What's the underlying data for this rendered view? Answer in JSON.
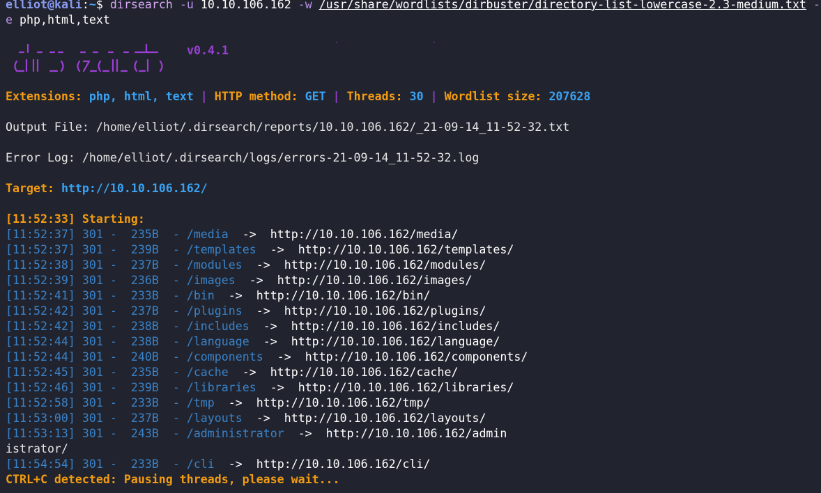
{
  "prompt": {
    "user": "elliot",
    "at": "@",
    "host": "kali",
    "sep": ":",
    "path": "~",
    "symbol": "$",
    "command": "dirsearch",
    "arg_u_flag": "-u",
    "target_ip": "10.10.106.162",
    "arg_w_flag": "-w",
    "wordlist": "/usr/share/wordlists/dirbuster/directory-list-lowercase-2.3-medium.txt",
    "arg_e_flag_start": "-",
    "arg_e_flag_end": "e",
    "extensions_arg": "php,html,text"
  },
  "banner": {
    "version": "v0.4.1"
  },
  "config": {
    "extensions_label": "Extensions:",
    "extensions_value": "php, html, text",
    "method_label": "HTTP method:",
    "method_value": "GET",
    "threads_label": "Threads:",
    "threads_value": "30",
    "wordlist_label": "Wordlist size:",
    "wordlist_value": "207628",
    "separator": "|"
  },
  "output_file": "Output File: /home/elliot/.dirsearch/reports/10.10.106.162/_21-09-14_11-52-32.txt",
  "error_log": "Error Log: /home/elliot/.dirsearch/logs/errors-21-09-14_11-52-32.log",
  "target": {
    "label": "Target:",
    "url": "http://10.10.106.162/"
  },
  "starting": "[11:52:33] Starting:",
  "results": [
    {
      "time": "[11:52:37]",
      "status": "301",
      "size": "235B",
      "path": "/media",
      "url": "http://10.10.106.162/media/"
    },
    {
      "time": "[11:52:37]",
      "status": "301",
      "size": "239B",
      "path": "/templates",
      "url": "http://10.10.106.162/templates/"
    },
    {
      "time": "[11:52:38]",
      "status": "301",
      "size": "237B",
      "path": "/modules",
      "url": "http://10.10.106.162/modules/"
    },
    {
      "time": "[11:52:39]",
      "status": "301",
      "size": "236B",
      "path": "/images",
      "url": "http://10.10.106.162/images/"
    },
    {
      "time": "[11:52:41]",
      "status": "301",
      "size": "233B",
      "path": "/bin",
      "url": "http://10.10.106.162/bin/"
    },
    {
      "time": "[11:52:42]",
      "status": "301",
      "size": "237B",
      "path": "/plugins",
      "url": "http://10.10.106.162/plugins/"
    },
    {
      "time": "[11:52:42]",
      "status": "301",
      "size": "238B",
      "path": "/includes",
      "url": "http://10.10.106.162/includes/"
    },
    {
      "time": "[11:52:44]",
      "status": "301",
      "size": "238B",
      "path": "/language",
      "url": "http://10.10.106.162/language/"
    },
    {
      "time": "[11:52:44]",
      "status": "301",
      "size": "240B",
      "path": "/components",
      "url": "http://10.10.106.162/components/"
    },
    {
      "time": "[11:52:45]",
      "status": "301",
      "size": "235B",
      "path": "/cache",
      "url": "http://10.10.106.162/cache/"
    },
    {
      "time": "[11:52:46]",
      "status": "301",
      "size": "239B",
      "path": "/libraries",
      "url": "http://10.10.106.162/libraries/"
    },
    {
      "time": "[11:52:58]",
      "status": "301",
      "size": "233B",
      "path": "/tmp",
      "url": "http://10.10.106.162/tmp/"
    },
    {
      "time": "[11:53:00]",
      "status": "301",
      "size": "237B",
      "path": "/layouts",
      "url": "http://10.10.106.162/layouts/"
    },
    {
      "time": "[11:53:13]",
      "status": "301",
      "size": "243B",
      "path": "/administrator",
      "url": "http://10.10.106.162/admin"
    },
    {
      "time": "[11:54:54]",
      "status": "301",
      "size": "233B",
      "path": "/cli",
      "url": "http://10.10.106.162/cli/"
    }
  ],
  "admin_wrap": "istrator/",
  "dash": "-",
  "arrow": "->",
  "ctrl_c": "CTRL+C detected: Pausing threads, please wait...",
  "colors": {
    "background": "#21242e",
    "accent_orange": "#f39c12",
    "accent_blue": "#3aa2f2",
    "accent_purple": "#9b3fd6",
    "row_blue": "#3a82c8"
  }
}
